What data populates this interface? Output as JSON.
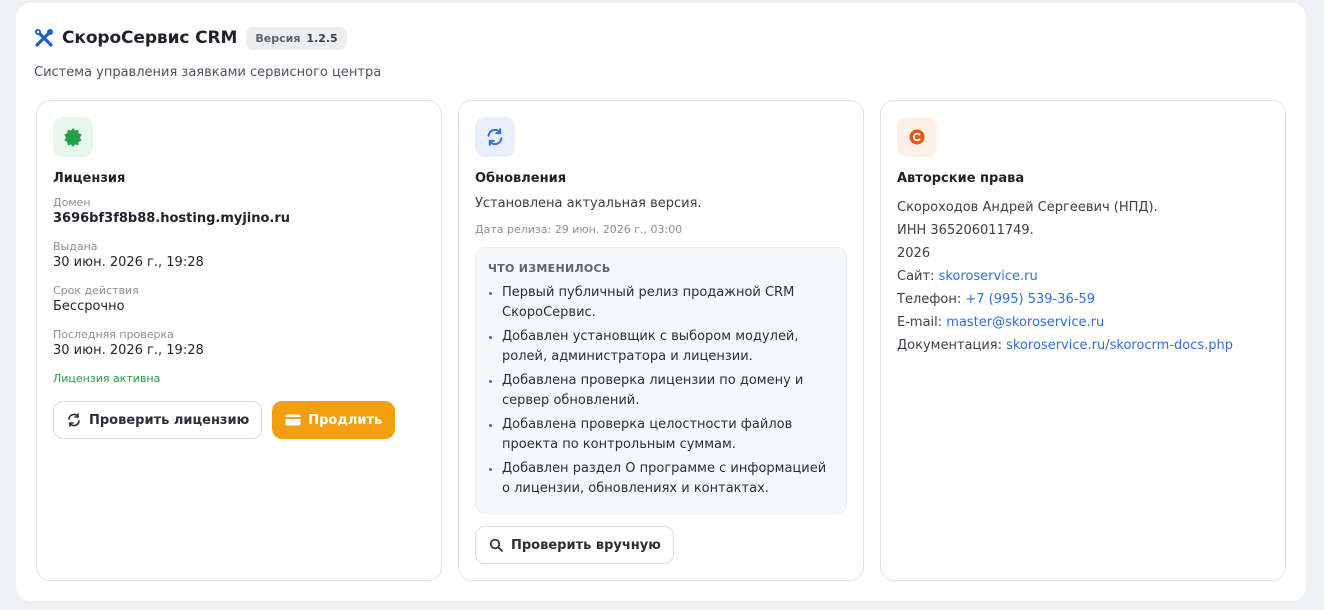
{
  "app": {
    "title": "СкороСервис CRM",
    "version_label": "Версия",
    "version": "1.2.5",
    "subtitle": "Система управления заявками сервисного центра"
  },
  "license": {
    "title": "Лицензия",
    "domain_label": "Домен",
    "domain": "3696bf3f8b88.hosting.myjino.ru",
    "issued_label": "Выдана",
    "issued": "30 июн. 2026 г., 19:28",
    "term_label": "Срок действия",
    "term": "Бессрочно",
    "last_check_label": "Последняя проверка",
    "last_check": "30 июн. 2026 г., 19:28",
    "status": "Лицензия активна",
    "check_button": "Проверить лицензию",
    "renew_button": "Продлить"
  },
  "updates": {
    "title": "Обновления",
    "status": "Установлена актуальная версия.",
    "release_date": "Дата релиза: 29 июн. 2026 г., 03:00",
    "changes_title": "ЧТО ИЗМЕНИЛОСЬ",
    "changes": [
      "Первый публичный релиз продажной CRM СкороСервис.",
      "Добавлен установщик с выбором модулей, ролей, администратора и лицензии.",
      "Добавлена проверка лицензии по домену и сервер обновлений.",
      "Добавлена проверка целостности файлов проекта по контрольным суммам.",
      "Добавлен раздел О программе с информацией о лицензии, обновлениях и контактах."
    ],
    "manual_check_button": "Проверить вручную"
  },
  "copyright": {
    "title": "Авторские права",
    "owner": "Скороходов Андрей Сергеевич (НПД).",
    "inn": "ИНН 365206011749.",
    "year": "2026",
    "site_label": "Сайт:",
    "site": "skoroservice.ru",
    "phone_label": "Телефон:",
    "phone": "+7 (995) 539-36-59",
    "email_label": "E-mail:",
    "email": "master@skoroservice.ru",
    "docs_label": "Документация:",
    "docs": "skoroservice.ru/skorocrm-docs.php"
  },
  "colors": {
    "accent_blue": "#2f6fde",
    "accent_orange": "#f3a010",
    "success_green": "#2b9a46"
  },
  "icons": {
    "app": "tools-icon",
    "license": "badge-check-icon",
    "updates": "refresh-icon",
    "copyright": "copyright-icon",
    "check": "refresh-icon",
    "renew": "credit-card-icon",
    "manual": "search-icon"
  }
}
